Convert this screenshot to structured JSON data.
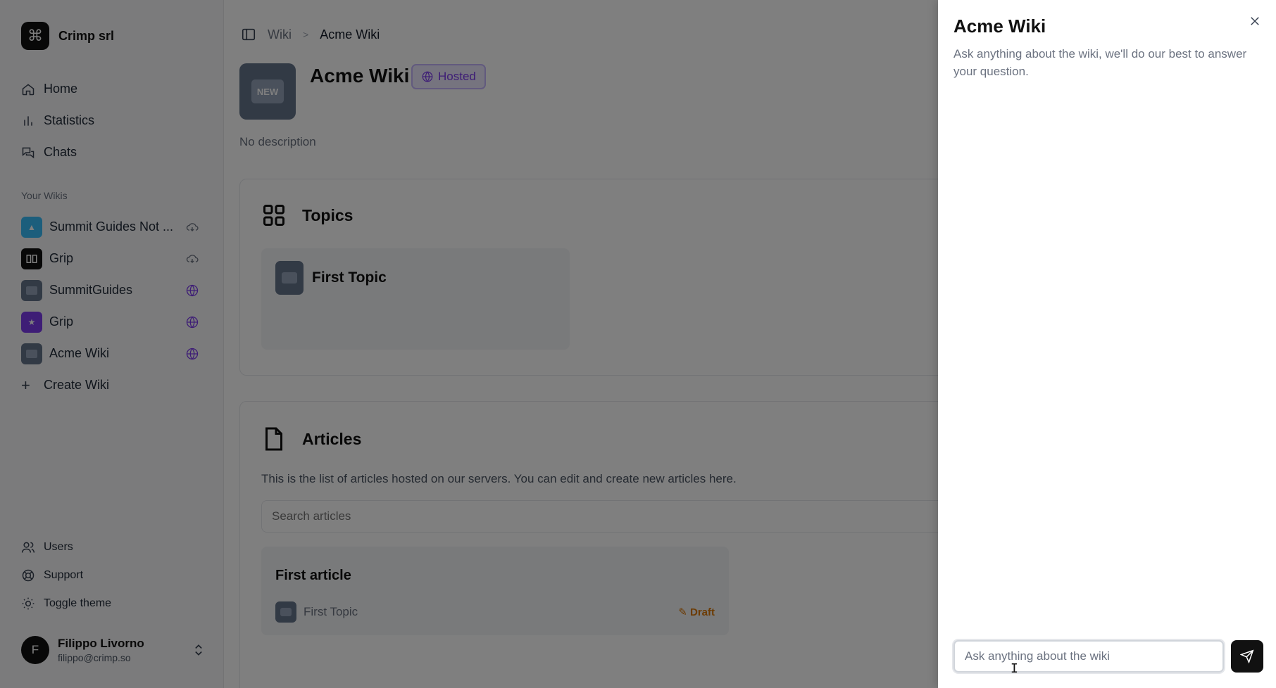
{
  "org": {
    "name": "Crimp srl",
    "logo_glyph": "⌘"
  },
  "nav": [
    {
      "label": "Home",
      "icon": "home-icon"
    },
    {
      "label": "Statistics",
      "icon": "bar-chart-icon"
    },
    {
      "label": "Chats",
      "icon": "chats-icon"
    }
  ],
  "wikis_section": {
    "label": "Your Wikis"
  },
  "wikis": [
    {
      "label": "Summit Guides Not ...",
      "thumb_color": "#38bdf8",
      "status": "cloud-sync-icon"
    },
    {
      "label": "Grip",
      "thumb_color": "#111111",
      "status": "cloud-sync-icon"
    },
    {
      "label": "SummitGuides",
      "thumb_color": "#64748b",
      "status": "globe-icon"
    },
    {
      "label": "Grip",
      "thumb_color": "#7c3aed",
      "status": "globe-icon"
    },
    {
      "label": "Acme Wiki",
      "thumb_color": "#64748b",
      "status": "globe-icon"
    }
  ],
  "create_wiki": {
    "label": "Create Wiki"
  },
  "bottom_nav": [
    {
      "label": "Users",
      "icon": "users-icon"
    },
    {
      "label": "Support",
      "icon": "support-icon"
    },
    {
      "label": "Toggle theme",
      "icon": "sun-icon"
    }
  ],
  "user": {
    "initial": "F",
    "name": "Filippo Livorno",
    "email": "filippo@crimp.so"
  },
  "breadcrumb": {
    "root": "Wiki",
    "separator": ">",
    "current": "Acme Wiki"
  },
  "wiki": {
    "thumb_text": "NEW",
    "title": "Acme Wiki",
    "badge": "Hosted",
    "description": "No description"
  },
  "topics": {
    "title": "Topics",
    "items": [
      {
        "name": "First Topic"
      }
    ]
  },
  "articles": {
    "title": "Articles",
    "description": "This is the list of articles hosted on our servers. You can edit and create new articles here.",
    "search_placeholder": "Search articles",
    "items": [
      {
        "title": "First article",
        "topic": "First Topic",
        "status": "Draft"
      }
    ]
  },
  "chat_panel": {
    "title": "Acme Wiki",
    "subtitle": "Ask anything about the wiki, we'll do our best to answer your question.",
    "input_placeholder": "Ask anything about the wiki"
  },
  "colors": {
    "accent_purple": "#7c3aed",
    "draft_amber": "#d97706",
    "overlay": "rgba(0,0,0,0.5)"
  }
}
